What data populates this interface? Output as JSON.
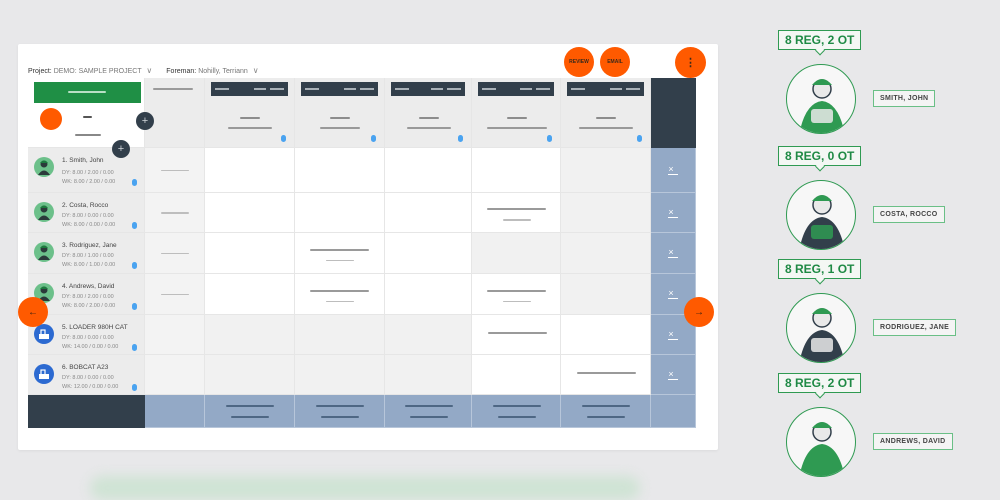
{
  "toolbar": {
    "project_label": "Project:",
    "project_value": "DEMO: SAMPLE PROJECT",
    "foreman_label": "Foreman:",
    "foreman_value": "Nohilly, Terriann",
    "review_label": "REVIEW",
    "email_label": "EMAIL",
    "more_icon": "⋮"
  },
  "nav": {
    "prev_icon": "←",
    "next_icon": "→"
  },
  "rows": [
    {
      "name": "1. Smith, John",
      "dy": "DY: 8.00 / 2.00 / 0.00",
      "wk": "WK: 8.00 / 2.00 / 0.00",
      "type": "person"
    },
    {
      "name": "2. Costa, Rocco",
      "dy": "DY: 8.00 / 0.00 / 0.00",
      "wk": "WK: 8.00 / 0.00 / 0.00",
      "type": "person"
    },
    {
      "name": "3. Rodriguez, Jane",
      "dy": "DY: 8.00 / 1.00 / 0.00",
      "wk": "WK: 8.00 / 1.00 / 0.00",
      "type": "person"
    },
    {
      "name": "4. Andrews, David",
      "dy": "DY: 8.00 / 2.00 / 0.00",
      "wk": "WK: 8.00 / 2.00 / 0.00",
      "type": "person"
    },
    {
      "name": "5. LOADER 980H CAT",
      "dy": "DY: 8.00 / 0.00 / 0.00",
      "wk": "WK: 14.00 / 0.00 / 0.00",
      "type": "machine"
    },
    {
      "name": "6. BOBCAT A23",
      "dy": "DY: 8.00 / 0.00 / 0.00",
      "wk": "WK: 12.00 / 0.00 / 0.00",
      "type": "machine"
    }
  ],
  "remove_label": "×",
  "colors": {
    "accent_orange": "#ff5a00",
    "header_green": "#1f8f45",
    "dark_slate": "#323f4b",
    "steel_blue": "#93a9c6",
    "badge_green": "#1f8a45"
  },
  "workers": [
    {
      "hours": "8 REG, 2 OT",
      "name": "SMITH, JOHN"
    },
    {
      "hours": "8 REG, 0 OT",
      "name": "COSTA, ROCCO"
    },
    {
      "hours": "8 REG, 1 OT",
      "name": "RODRIGUEZ, JANE"
    },
    {
      "hours": "8 REG, 2 OT",
      "name": "ANDREWS, DAVID"
    }
  ]
}
